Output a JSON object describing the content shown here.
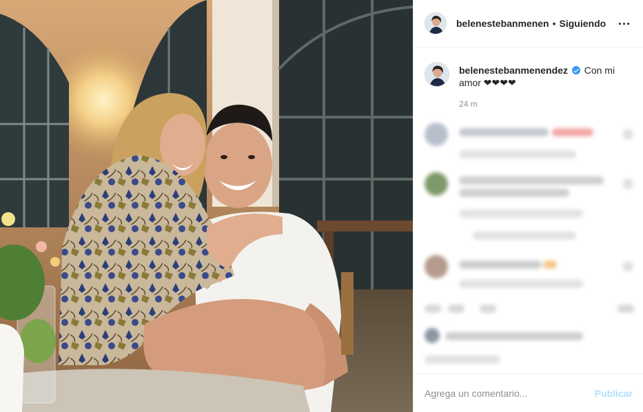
{
  "post": {
    "header": {
      "username": "belenestebanmenen",
      "separator": "•",
      "follow_status": "Siguiendo",
      "more_icon": "more-horizontal-icon"
    },
    "caption": {
      "username": "belenestebanmenendez",
      "verified": true,
      "text_line1": "Con mi",
      "text_line2": "amor ❤❤❤❤"
    },
    "timestamp": "24 m",
    "comment_box": {
      "placeholder": "Agrega un comentario...",
      "publish_label": "Publicar"
    }
  },
  "colors": {
    "text": "#262626",
    "muted": "#8e8e8e",
    "publish_disabled": "#b2dffc",
    "verified": "#3897f0",
    "border": "#efefef"
  }
}
